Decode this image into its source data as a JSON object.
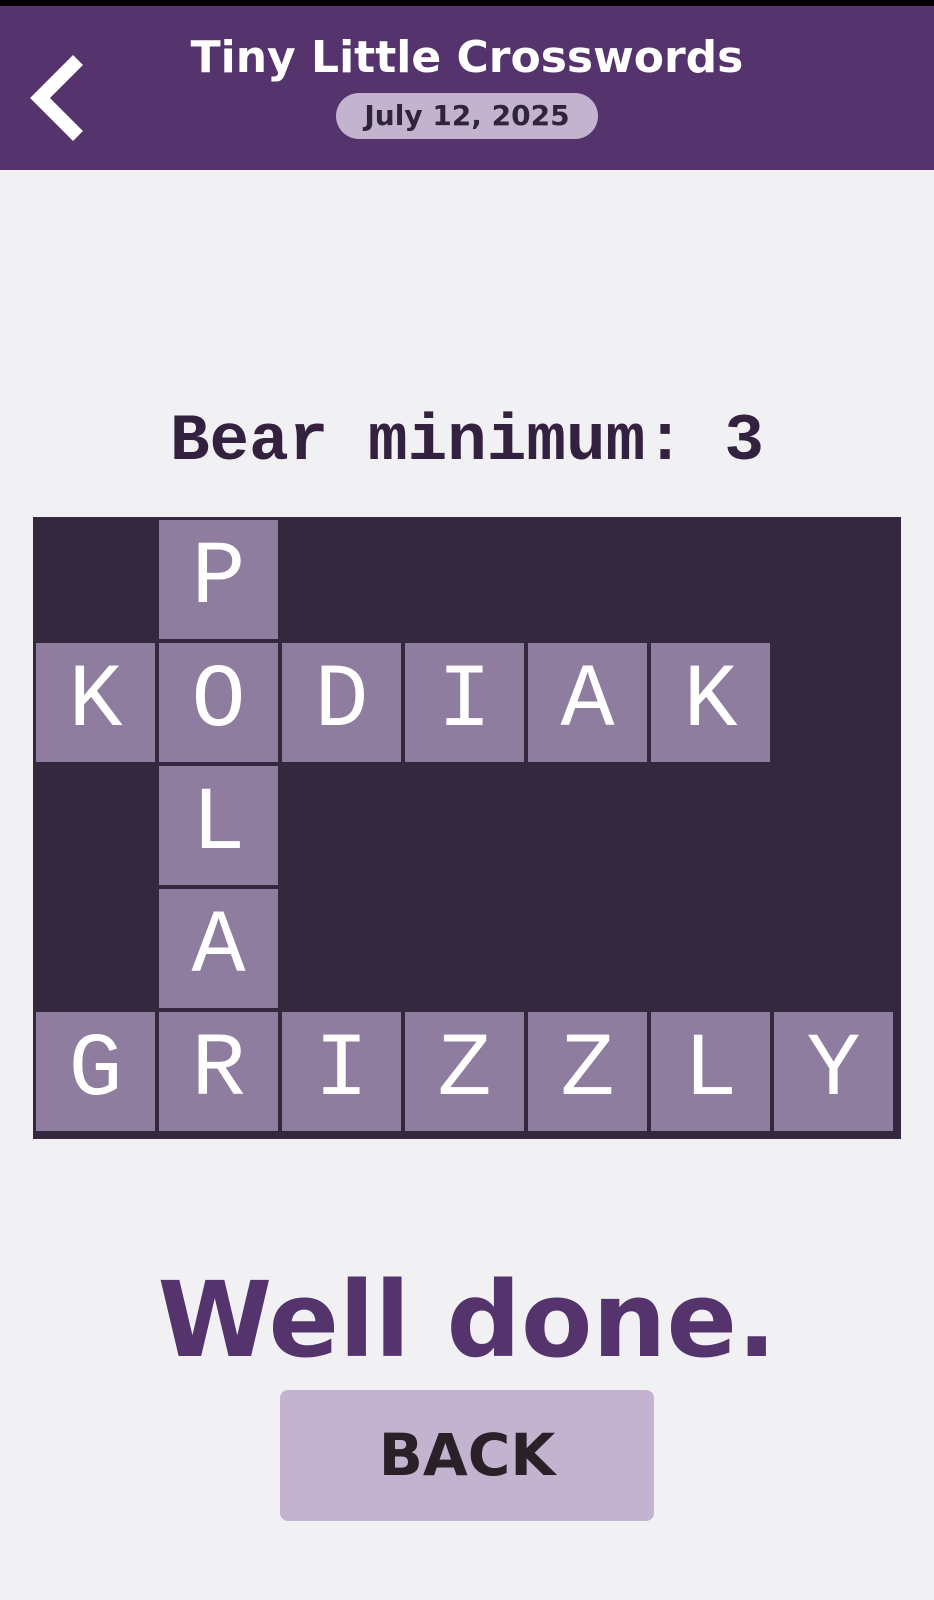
{
  "header": {
    "title": "Tiny Little Crosswords",
    "date": "July 12, 2025",
    "back_icon": "chevron-left-icon",
    "background_color": "#55336c",
    "date_pill_color": "#c3b3cf"
  },
  "puzzle": {
    "clue": "Bear minimum: 3",
    "rows": 5,
    "cols": 7,
    "grid": [
      [
        "",
        "P",
        "",
        "",
        "",
        "",
        ""
      ],
      [
        "K",
        "O",
        "D",
        "I",
        "A",
        "K",
        ""
      ],
      [
        "",
        "L",
        "",
        "",
        "",
        "",
        ""
      ],
      [
        "",
        "A",
        "",
        "",
        "",
        "",
        ""
      ],
      [
        "G",
        "R",
        "I",
        "Z",
        "Z",
        "L",
        "Y"
      ]
    ],
    "cell_color": "#8f7d9f",
    "block_color": "#33283e"
  },
  "result": {
    "message": "Well done.",
    "back_label": "BACK"
  }
}
